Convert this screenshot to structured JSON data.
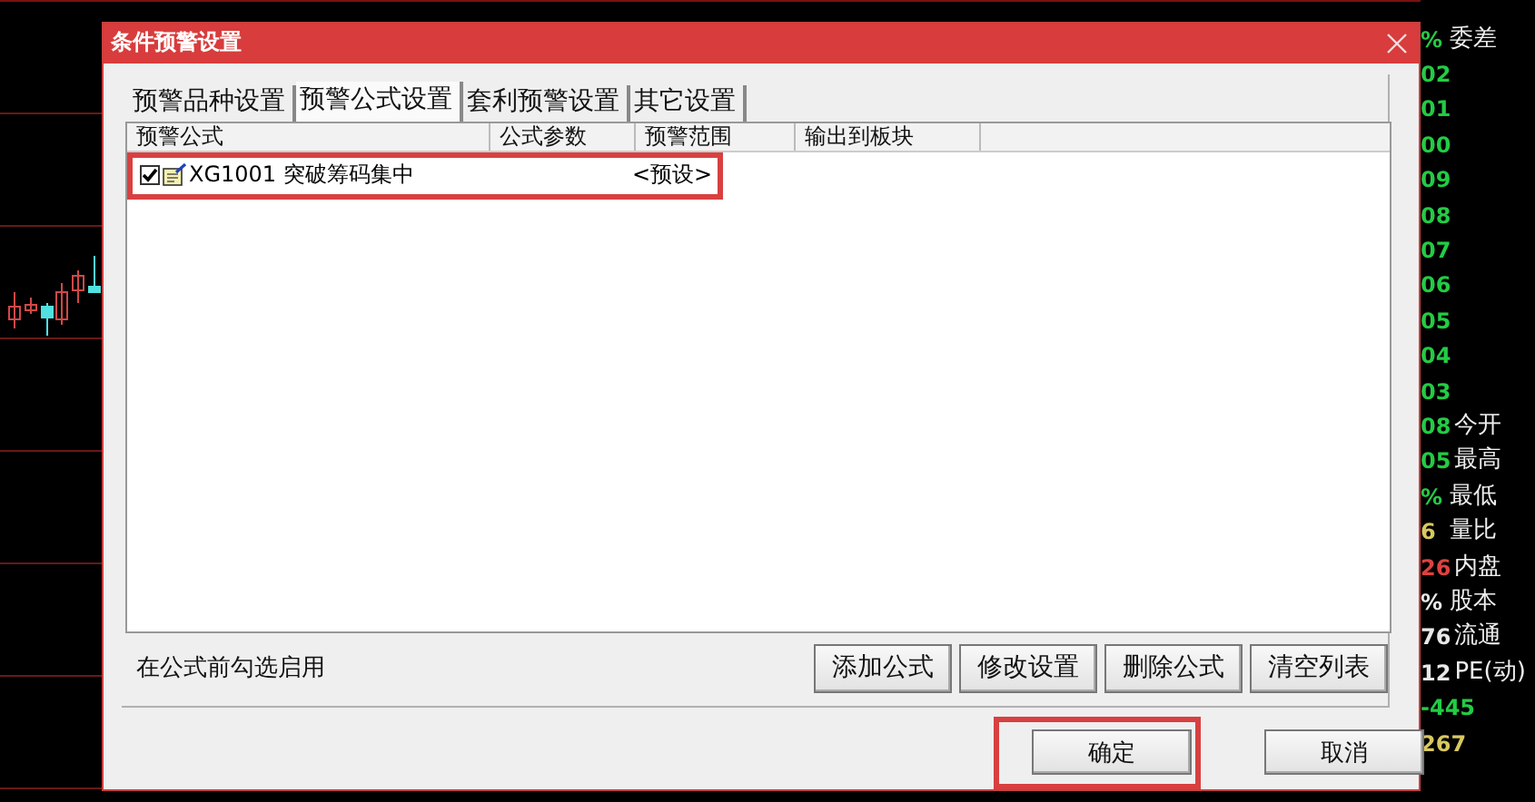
{
  "window": {
    "title": "条件预警设置"
  },
  "tabs": [
    {
      "label": "预警品种设置",
      "selected": false
    },
    {
      "label": "预警公式设置",
      "selected": true
    },
    {
      "label": "套利预警设置",
      "selected": false
    },
    {
      "label": "其它设置",
      "selected": false
    }
  ],
  "table": {
    "columns": [
      "预警公式",
      "公式参数",
      "预警范围",
      "输出到板块"
    ],
    "rows": [
      {
        "checked": true,
        "highlighted": true,
        "formula": "XG1001 突破筹码集中",
        "range": "<预设>"
      }
    ]
  },
  "hint": "在公式前勾选启用",
  "actions": [
    "添加公式",
    "修改设置",
    "删除公式",
    "清空列表"
  ],
  "footer_buttons": [
    {
      "label": "确定",
      "highlighted": true
    },
    {
      "label": "取消",
      "highlighted": false
    }
  ],
  "quote_panel": [
    [
      {
        "kind": "value",
        "text": "%",
        "color": "#22cc44"
      },
      {
        "kind": "label",
        "text": "委差"
      }
    ],
    [
      {
        "kind": "value",
        "text": "02",
        "color": "#22cc44"
      }
    ],
    [
      {
        "kind": "value",
        "text": "01",
        "color": "#22cc44"
      }
    ],
    [
      {
        "kind": "value",
        "text": "00",
        "color": "#22cc44"
      }
    ],
    [
      {
        "kind": "value",
        "text": "09",
        "color": "#22cc44"
      }
    ],
    [
      {
        "kind": "value",
        "text": "08",
        "color": "#22cc44"
      }
    ],
    [
      {
        "kind": "value",
        "text": "07",
        "color": "#22cc44"
      }
    ],
    [
      {
        "kind": "value",
        "text": "06",
        "color": "#22cc44"
      }
    ],
    [
      {
        "kind": "value",
        "text": "05",
        "color": "#22cc44"
      }
    ],
    [
      {
        "kind": "value",
        "text": "04",
        "color": "#22cc44"
      }
    ],
    [
      {
        "kind": "value",
        "text": "03",
        "color": "#22cc44"
      }
    ],
    [
      {
        "kind": "value",
        "text": "08",
        "color": "#22cc44"
      },
      {
        "kind": "label",
        "text": "今开"
      }
    ],
    [
      {
        "kind": "value",
        "text": "05",
        "color": "#22cc44"
      },
      {
        "kind": "label",
        "text": "最高"
      }
    ],
    [
      {
        "kind": "value",
        "text": "%",
        "color": "#22cc44"
      },
      {
        "kind": "label",
        "text": "最低"
      }
    ],
    [
      {
        "kind": "value",
        "text": "6",
        "color": "#d8c860"
      },
      {
        "kind": "label",
        "text": "量比"
      }
    ],
    [
      {
        "kind": "value",
        "text": "26",
        "color": "#e04040"
      },
      {
        "kind": "label",
        "text": "内盘"
      }
    ],
    [
      {
        "kind": "value",
        "text": "%",
        "color": "#e8e8e8"
      },
      {
        "kind": "label",
        "text": "股本"
      }
    ],
    [
      {
        "kind": "value",
        "text": "76",
        "color": "#e8e8e8"
      },
      {
        "kind": "label",
        "text": "流通"
      }
    ],
    [
      {
        "kind": "value",
        "text": "12",
        "color": "#e8e8e8"
      },
      {
        "kind": "label",
        "text": "PE(动)"
      }
    ],
    [
      {
        "kind": "value",
        "text": "-445",
        "color": "#22cc44"
      }
    ],
    [
      {
        "kind": "value",
        "text": "267",
        "color": "#d8c860"
      }
    ]
  ]
}
